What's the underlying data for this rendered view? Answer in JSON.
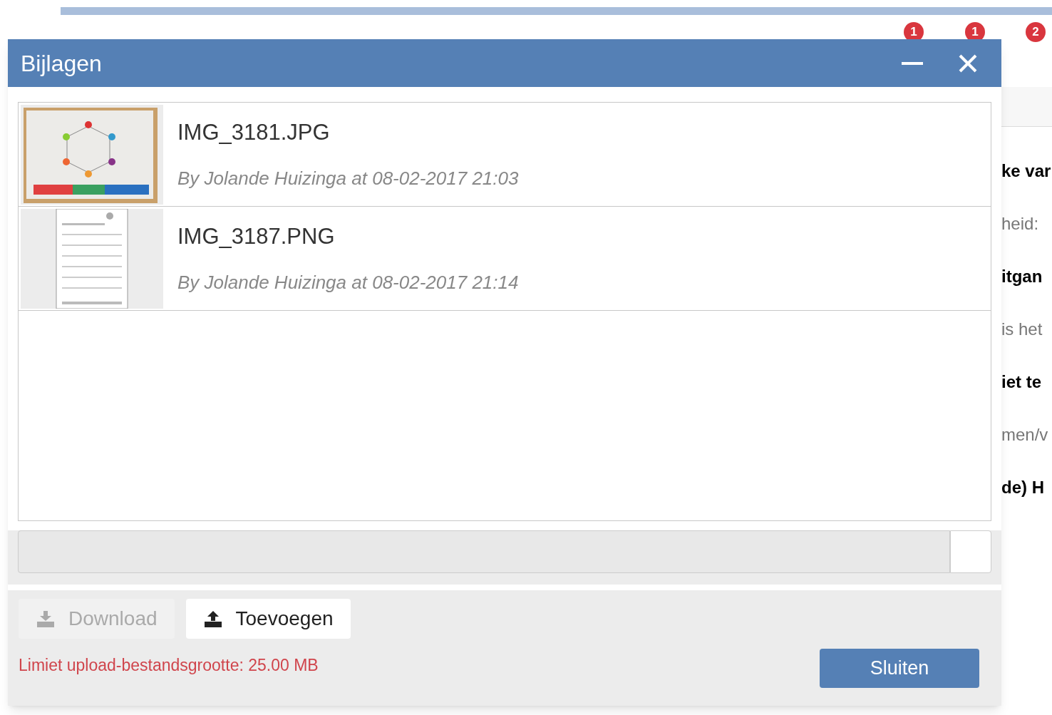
{
  "background": {
    "badges": [
      "1",
      "1",
      "2"
    ],
    "side_texts": [
      {
        "text": "ke var",
        "bold": true
      },
      {
        "text": "heid:",
        "bold": false
      },
      {
        "text": "itgan",
        "bold": true
      },
      {
        "text": "is het",
        "bold": false
      },
      {
        "text": "iet te",
        "bold": true
      },
      {
        "text": "men/v",
        "bold": false
      },
      {
        "text": "de) H",
        "bold": true
      }
    ]
  },
  "dialog": {
    "title": "Bijlagen",
    "attachments": [
      {
        "name": "IMG_3181.JPG",
        "meta": "By Jolande Huizinga at 08-02-2017 21:03"
      },
      {
        "name": "IMG_3187.PNG",
        "meta": "By Jolande Huizinga at 08-02-2017 21:14",
        "kind": "document"
      }
    ],
    "buttons": [
      {
        "label": "Download",
        "kind": "download",
        "disabled": true
      },
      {
        "label": "Toevoegen",
        "kind": "upload",
        "disabled": false
      }
    ],
    "limit_text": "Limiet upload-bestandsgrootte: 25.00 MB",
    "close_button": "Sluiten"
  }
}
